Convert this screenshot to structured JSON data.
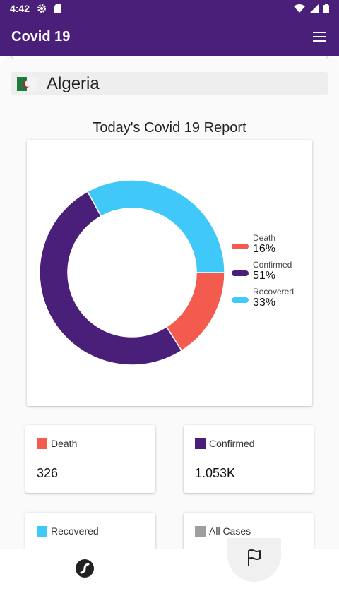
{
  "status_bar": {
    "time": "4:42"
  },
  "app_bar": {
    "title": "Covid 19"
  },
  "country": {
    "name": "Algeria"
  },
  "report": {
    "title": "Today's Covid 19 Report"
  },
  "chart_data": {
    "type": "pie",
    "categories": [
      "Death",
      "Confirmed",
      "Recovered"
    ],
    "values": [
      16,
      51,
      33
    ],
    "labels": [
      "16%",
      "51%",
      "33%"
    ],
    "colors": [
      "#f45b4f",
      "#4a1f7a",
      "#40c8f8"
    ],
    "legend": "right"
  },
  "stats": [
    {
      "label": "Death",
      "value": "326",
      "color": "#f45b4f"
    },
    {
      "label": "Confirmed",
      "value": "1.053K",
      "color": "#4a1f7a"
    },
    {
      "label": "Recovered",
      "value": "",
      "color": "#40c8f8"
    },
    {
      "label": "All Cases",
      "value": "",
      "color": "#9e9e9e"
    }
  ],
  "icons": {
    "status": [
      "gear-icon",
      "sd-card-icon",
      "wifi-icon",
      "signal-icon",
      "battery-icon"
    ],
    "menu": "hamburger-menu-icon",
    "nav": [
      "virus-stats-icon",
      "flag-icon"
    ]
  },
  "colors": {
    "primary": "#4a1f7a"
  }
}
